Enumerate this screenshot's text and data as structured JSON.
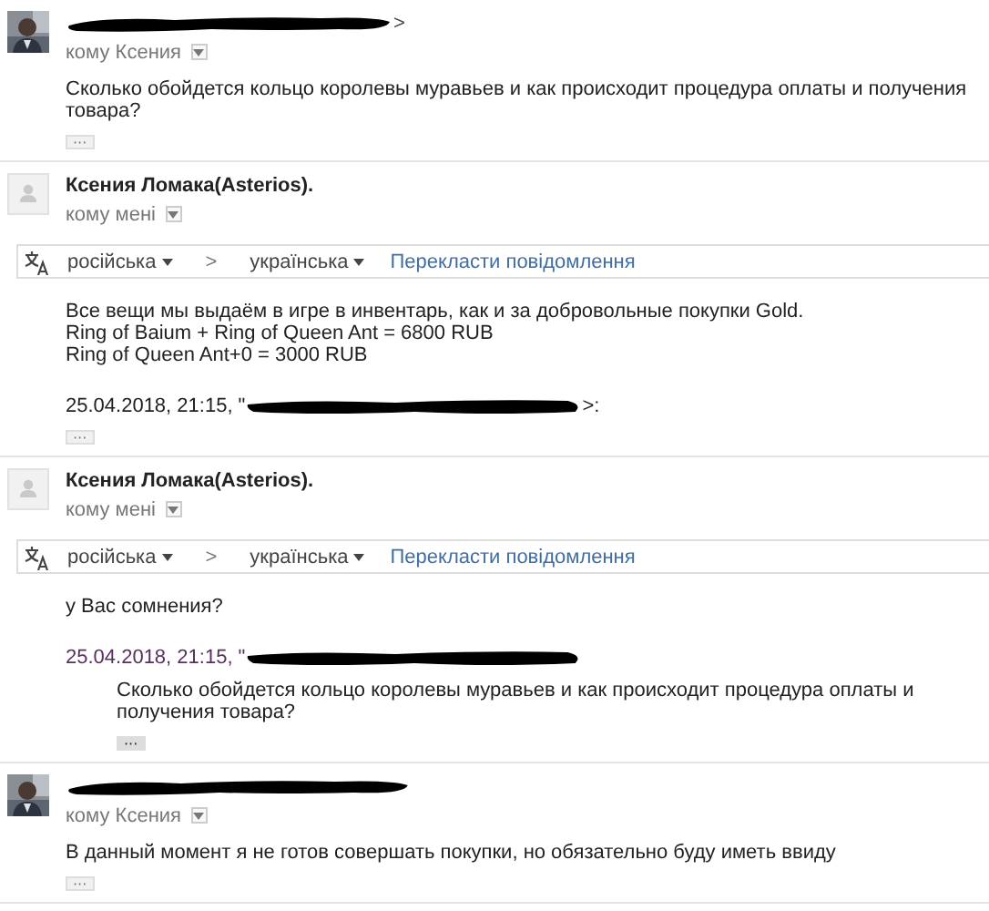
{
  "messages": [
    {
      "sender_redacted": true,
      "sender": ">",
      "recipient": "кому Ксения",
      "body": [
        "Сколько обойдется кольцо королевы муравьев и как происходит процедура оплаты и получения товара?"
      ],
      "trimmed": "···"
    },
    {
      "avatar": {
        "kind": "placeholder"
      },
      "sender_redacted": false,
      "sender": "Ксения Ломака(Asterios).",
      "recipient": "кому мені",
      "translation": {
        "from": "російська",
        "separator": ">",
        "to": "українська",
        "action": "Перекласти повідомлення"
      },
      "body": [
        "Все вещи мы выдаём в игре в инвентарь, как и за добровольные покупки Gold.",
        "Ring of Baium + Ring of Queen Ant = 6800 RUB",
        "Ring of Queen Ant+0 = 3000 RUB"
      ],
      "quote": {
        "header": "25.04.2018, 21:15, \"",
        "tail": ">:",
        "expanded": false
      },
      "trimmed": "···"
    },
    {
      "avatar": {
        "kind": "placeholder"
      },
      "sender_redacted": false,
      "sender": "Ксения Ломака(Asterios).",
      "recipient": "кому мені",
      "translation": {
        "from": "російська",
        "separator": ">",
        "to": "українська",
        "action": "Перекласти повідомлення"
      },
      "body": [
        "у Вас сомнения?"
      ],
      "quote": {
        "header": "25.04.2018, 21:15, \"",
        "expanded": true,
        "text": "Сколько обойдется кольцо королевы муравьев и как происходит процедура оплаты и получения товара?"
      },
      "trimmed": "···"
    },
    {
      "sender_redacted": true,
      "recipient": "кому Ксения",
      "body": [
        "В данный момент я не готов совершать покупки, но обязательно буду иметь ввиду"
      ],
      "trimmed": "···"
    }
  ]
}
